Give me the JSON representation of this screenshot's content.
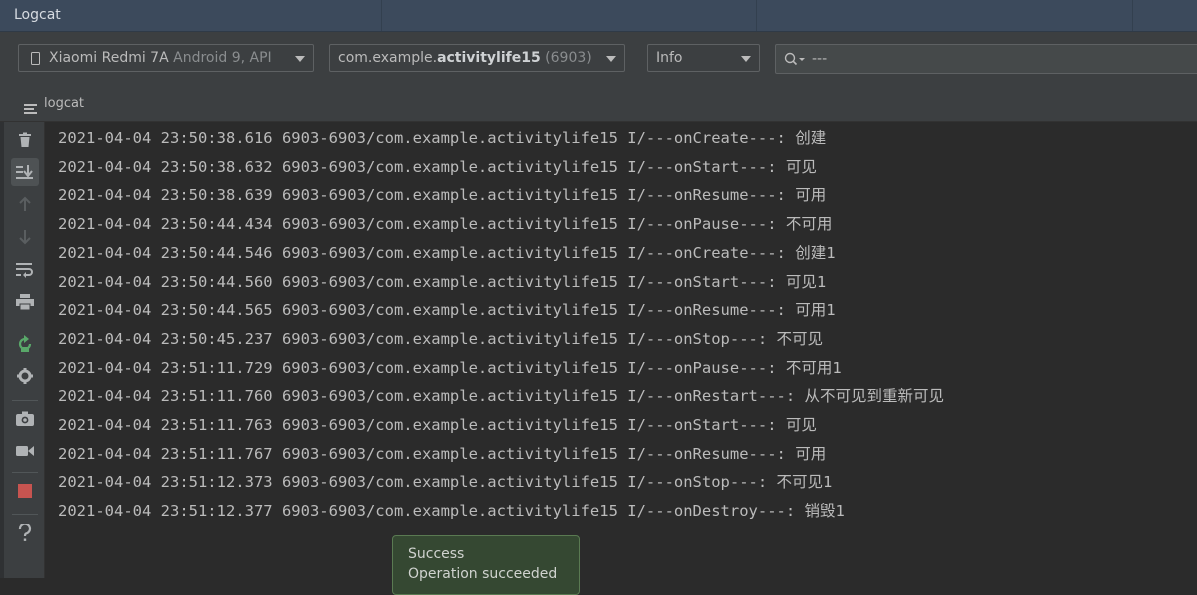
{
  "window": {
    "title": "Logcat"
  },
  "toolbar": {
    "device": {
      "name": "Xiaomi Redmi 7A",
      "detail": "Android 9, API"
    },
    "process": {
      "prefix": "com.example.",
      "name": "activitylife15",
      "pid": "(6903)"
    },
    "log_level": "Info",
    "search": {
      "value": "---"
    }
  },
  "tab": {
    "label": "logcat"
  },
  "side_tools": [
    "trash-icon",
    "scroll-to-end-icon",
    "arrow-up-icon",
    "arrow-down-icon",
    "soft-wrap-icon",
    "print-icon",
    "restart-icon",
    "gear-icon",
    "camera-icon",
    "video-icon",
    "stop-icon",
    "help-icon"
  ],
  "log_lines": [
    "2021-04-04 23:50:38.616 6903-6903/com.example.activitylife15 I/---onCreate---: 创建",
    "2021-04-04 23:50:38.632 6903-6903/com.example.activitylife15 I/---onStart---: 可见",
    "2021-04-04 23:50:38.639 6903-6903/com.example.activitylife15 I/---onResume---: 可用",
    "2021-04-04 23:50:44.434 6903-6903/com.example.activitylife15 I/---onPause---: 不可用",
    "2021-04-04 23:50:44.546 6903-6903/com.example.activitylife15 I/---onCreate---: 创建1",
    "2021-04-04 23:50:44.560 6903-6903/com.example.activitylife15 I/---onStart---: 可见1",
    "2021-04-04 23:50:44.565 6903-6903/com.example.activitylife15 I/---onResume---: 可用1",
    "2021-04-04 23:50:45.237 6903-6903/com.example.activitylife15 I/---onStop---: 不可见",
    "2021-04-04 23:51:11.729 6903-6903/com.example.activitylife15 I/---onPause---: 不可用1",
    "2021-04-04 23:51:11.760 6903-6903/com.example.activitylife15 I/---onRestart---: 从不可见到重新可见",
    "2021-04-04 23:51:11.763 6903-6903/com.example.activitylife15 I/---onStart---: 可见",
    "2021-04-04 23:51:11.767 6903-6903/com.example.activitylife15 I/---onResume---: 可用",
    "2021-04-04 23:51:12.373 6903-6903/com.example.activitylife15 I/---onStop---: 不可见1",
    "2021-04-04 23:51:12.377 6903-6903/com.example.activitylife15 I/---onDestroy---: 销毁1"
  ],
  "toast": {
    "title": "Success",
    "message": "Operation succeeded"
  },
  "colors": {
    "stop": "#c75450",
    "restart": "#59a869"
  }
}
